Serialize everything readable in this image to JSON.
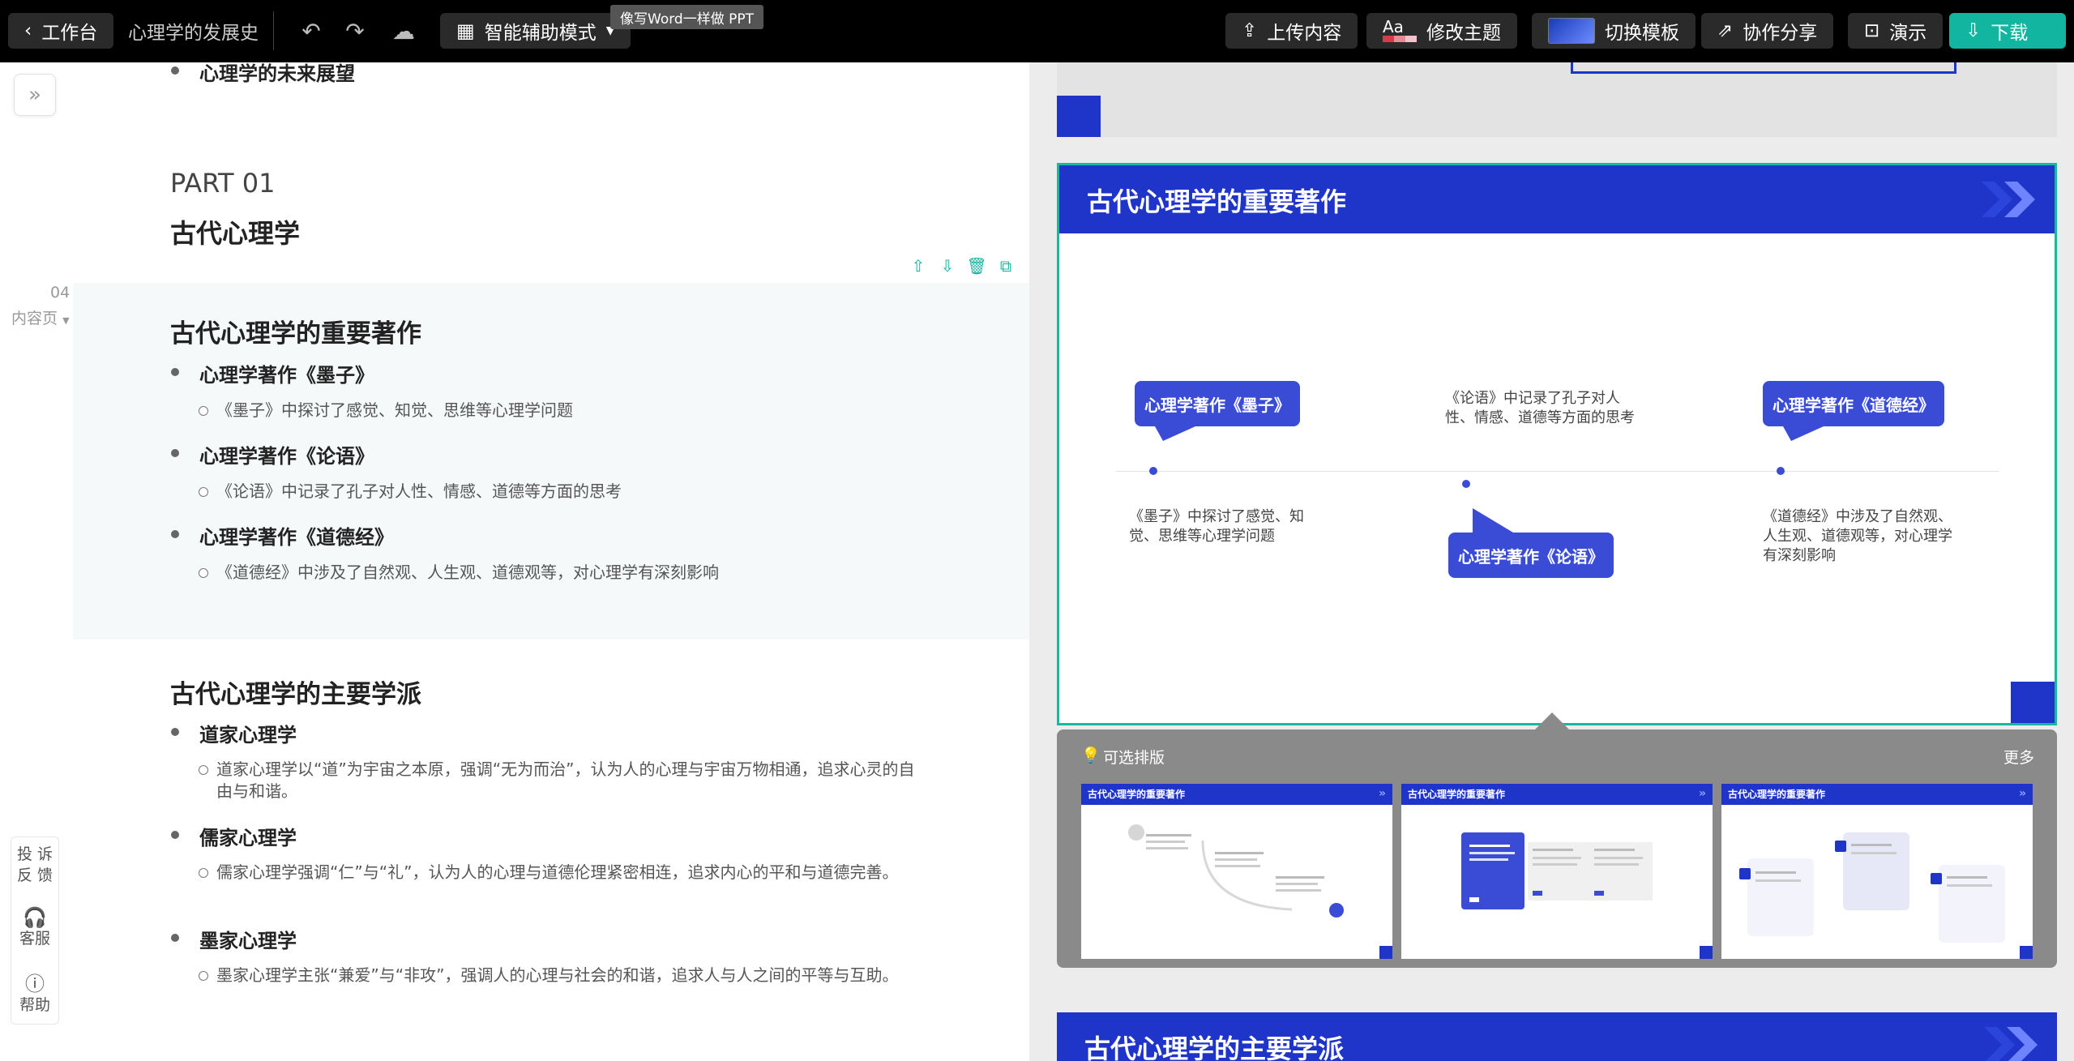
{
  "topbar": {
    "back_label": "工作台",
    "doc_title": "心理学的发展史",
    "mode_label": "智能辅助模式",
    "tooltip": "像写Word一样做 PPT",
    "upload_label": "上传内容",
    "theme_label": "修改主题",
    "theme_aa": "Aa",
    "template_label": "切换模板",
    "share_label": "协作分享",
    "present_label": "演示",
    "download_label": "下载"
  },
  "editor": {
    "top_bullet": "心理学的未来展望",
    "part_label": "PART 01",
    "part_title": "古代心理学",
    "page_number": "04",
    "page_type": "内容页",
    "section1": {
      "title": "古代心理学的重要著作",
      "items": [
        {
          "heading": "心理学著作《墨子》",
          "detail": "《墨子》中探讨了感觉、知觉、思维等心理学问题"
        },
        {
          "heading": "心理学著作《论语》",
          "detail": "《论语》中记录了孔子对人性、情感、道德等方面的思考"
        },
        {
          "heading": "心理学著作《道德经》",
          "detail": "《道德经》中涉及了自然观、人生观、道德观等，对心理学有深刻影响"
        }
      ]
    },
    "section2": {
      "title": "古代心理学的主要学派",
      "items": [
        {
          "heading": "道家心理学",
          "detail": "道家心理学以“道”为宇宙之本原，强调“无为而治”，认为人的心理与宇宙万物相通，追求心灵的自由与和谐。"
        },
        {
          "heading": "儒家心理学",
          "detail": "儒家心理学强调“仁”与“礼”，认为人的心理与道德伦理紧密相连，追求内心的平和与道德完善。"
        },
        {
          "heading": "墨家心理学",
          "detail": "墨家心理学主张“兼爱”与“非攻”，强调人的心理与社会的和谐，追求人与人之间的平等与互助。"
        }
      ]
    },
    "side_help": {
      "complain_line1": "投 诉",
      "complain_line2": "反 馈",
      "service": "客服",
      "help": "帮助"
    }
  },
  "preview": {
    "slide_title": "古代心理学的重要著作",
    "callouts": [
      "心理学著作《墨子》",
      "心理学著作《论语》",
      "心理学著作《道德经》"
    ],
    "texts": [
      "《墨子》中探讨了感觉、知觉、思维等心理学问题",
      "《论语》中记录了孔子对人性、情感、道德等方面的思考",
      "《道德经》中涉及了自然观、人生观、道德观等，对心理学有深刻影响"
    ],
    "layout_panel_title": "可选排版",
    "layout_panel_more": "更多",
    "thumb_title": "古代心理学的重要著作",
    "next_slide_title": "古代心理学的主要学派",
    "brand_color": "#1f34c8",
    "accent_color": "#17b8a3"
  }
}
